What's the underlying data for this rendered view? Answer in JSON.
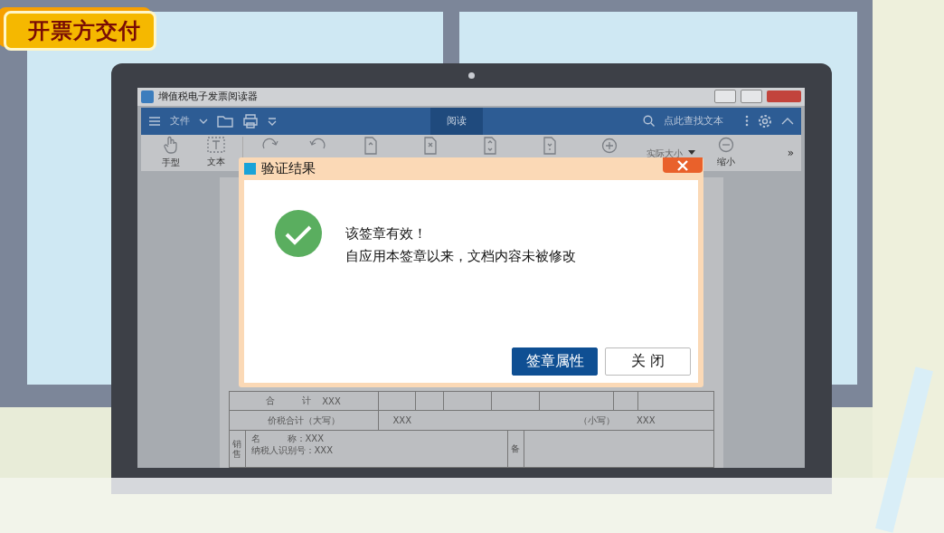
{
  "badge": {
    "text": "开票方交付"
  },
  "window": {
    "title": "增值税电子发票阅读器"
  },
  "toolbar": {
    "menu": "文件",
    "tabs": [
      {
        "label": "阅读",
        "selected": true
      }
    ],
    "search": {
      "placeholder": "点此查找文本"
    }
  },
  "ribbon": {
    "tools": [
      {
        "kind": "hand",
        "label": "手型"
      },
      {
        "kind": "text",
        "label": "文本"
      },
      {
        "kind": "rotate-cw"
      },
      {
        "kind": "rotate-ccw"
      },
      {
        "kind": "page-first"
      },
      {
        "kind": "page-prev"
      },
      {
        "kind": "page-next"
      },
      {
        "kind": "page-last"
      },
      {
        "kind": "zoom-in"
      }
    ],
    "zoom": {
      "value": "实际大小"
    },
    "zoom_out": "缩小",
    "more": "»"
  },
  "invoice": {
    "total_label": "合　　　计",
    "total": "XXX",
    "grand_label": "价税合计（大写）",
    "grand_words": "XXX",
    "small_label": "（小写）",
    "grand_figure": "XXX",
    "seller_label": "销售",
    "name_label": "名　　　称：",
    "name": "XXX",
    "tax_id_label": "纳税人识别号：",
    "tax_id": "XXX",
    "remarks_label": "备"
  },
  "dialog": {
    "title": "验证结果",
    "kind": "valid",
    "message": [
      "该签章有效！",
      "自应用本签章以来，文档内容未被修改"
    ],
    "buttons": [
      {
        "label": "签章属性",
        "primary": true
      },
      {
        "label": "关 闭",
        "primary": false
      }
    ]
  }
}
